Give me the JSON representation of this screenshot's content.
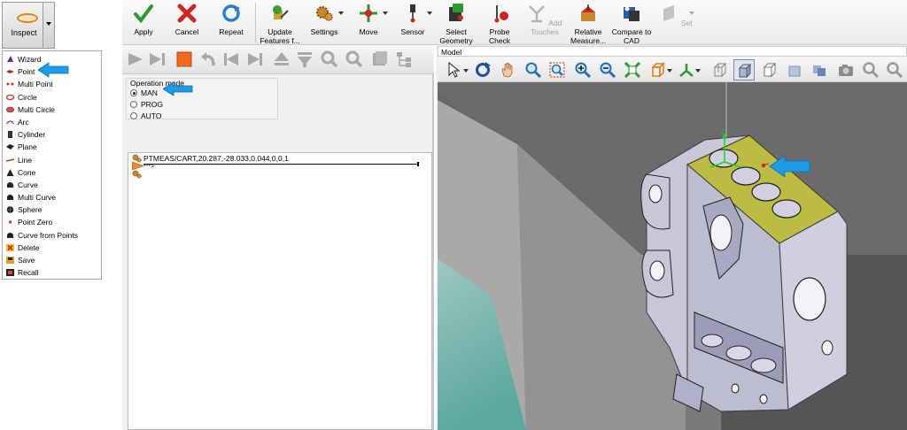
{
  "inspect": {
    "label": "Inspect",
    "menu": [
      {
        "label": "Wizard",
        "icon": "wizard-hat-icon",
        "color": "#5a2d82"
      },
      {
        "label": "Point",
        "icon": "point-icon",
        "color": "#c0392b"
      },
      {
        "label": "Multi Point",
        "icon": "multi-point-icon",
        "color": "#c0392b"
      },
      {
        "label": "Circle",
        "icon": "circle-icon",
        "color": "#c0392b"
      },
      {
        "label": "Multi Circle",
        "icon": "multi-circle-icon",
        "color": "#c0392b"
      },
      {
        "label": "Arc",
        "icon": "arc-icon",
        "color": "#c0392b"
      },
      {
        "label": "Cylinder",
        "icon": "cylinder-icon",
        "color": "#333333"
      },
      {
        "label": "Plane",
        "icon": "plane-icon",
        "color": "#222222"
      },
      {
        "label": "Line",
        "icon": "line-icon",
        "color": "#8a4b1e"
      },
      {
        "label": "Cone",
        "icon": "cone-icon",
        "color": "#222222"
      },
      {
        "label": "Curve",
        "icon": "curve-icon",
        "color": "#222222"
      },
      {
        "label": "Multi Curve",
        "icon": "multi-curve-icon",
        "color": "#222222"
      },
      {
        "label": "Sphere",
        "icon": "sphere-icon",
        "color": "#222222"
      },
      {
        "label": "Point Zero",
        "icon": "point-zero-icon",
        "color": "#c0392b"
      },
      {
        "label": "Curve from Points",
        "icon": "curve-from-points-icon",
        "color": "#222222"
      },
      {
        "label": "Delete",
        "icon": "delete-icon",
        "color": "#cc2222"
      },
      {
        "label": "Save",
        "icon": "save-icon",
        "color": "#222222"
      },
      {
        "label": "Recall",
        "icon": "recall-icon",
        "color": "#222222"
      }
    ]
  },
  "toolbar": {
    "buttons": [
      {
        "label": "Apply",
        "icon": "checkmark-icon"
      },
      {
        "label": "Cancel",
        "icon": "red-x-icon"
      },
      {
        "label": "Repeat",
        "icon": "repeat-icon"
      },
      {
        "label": "Update\nFeatures f...",
        "icon": "update-features-icon"
      },
      {
        "label": "Settings",
        "icon": "settings-gear-icon"
      },
      {
        "label": "Move",
        "icon": "move-icon"
      },
      {
        "label": "Sensor",
        "icon": "sensor-icon"
      },
      {
        "label": "Select\nGeometry",
        "icon": "select-geometry-icon"
      },
      {
        "label": "Probe\nCheck",
        "icon": "probe-check-icon"
      },
      {
        "label": "Add Touches",
        "icon": "add-touches-icon"
      },
      {
        "label": "Relative\nMeasure...",
        "icon": "relative-measure-icon"
      },
      {
        "label": "Compare to\nCAD",
        "icon": "compare-to-cad-icon"
      },
      {
        "label": "Set",
        "icon": "set-icon"
      }
    ]
  },
  "operation_mode": {
    "title": "Operation mode",
    "options": [
      "MAN",
      "PROG",
      "AUTO"
    ],
    "selected": "MAN"
  },
  "program": {
    "line1": "PTMEAS/CART,20.287,-28.033,0.044,0,0,1",
    "line2": "***>"
  },
  "model": {
    "title": "Model"
  },
  "colors": {
    "accent_blue": "#1e9be6",
    "part_face_yellow": "#c2c24a",
    "part_body": "#c4c4d6"
  }
}
